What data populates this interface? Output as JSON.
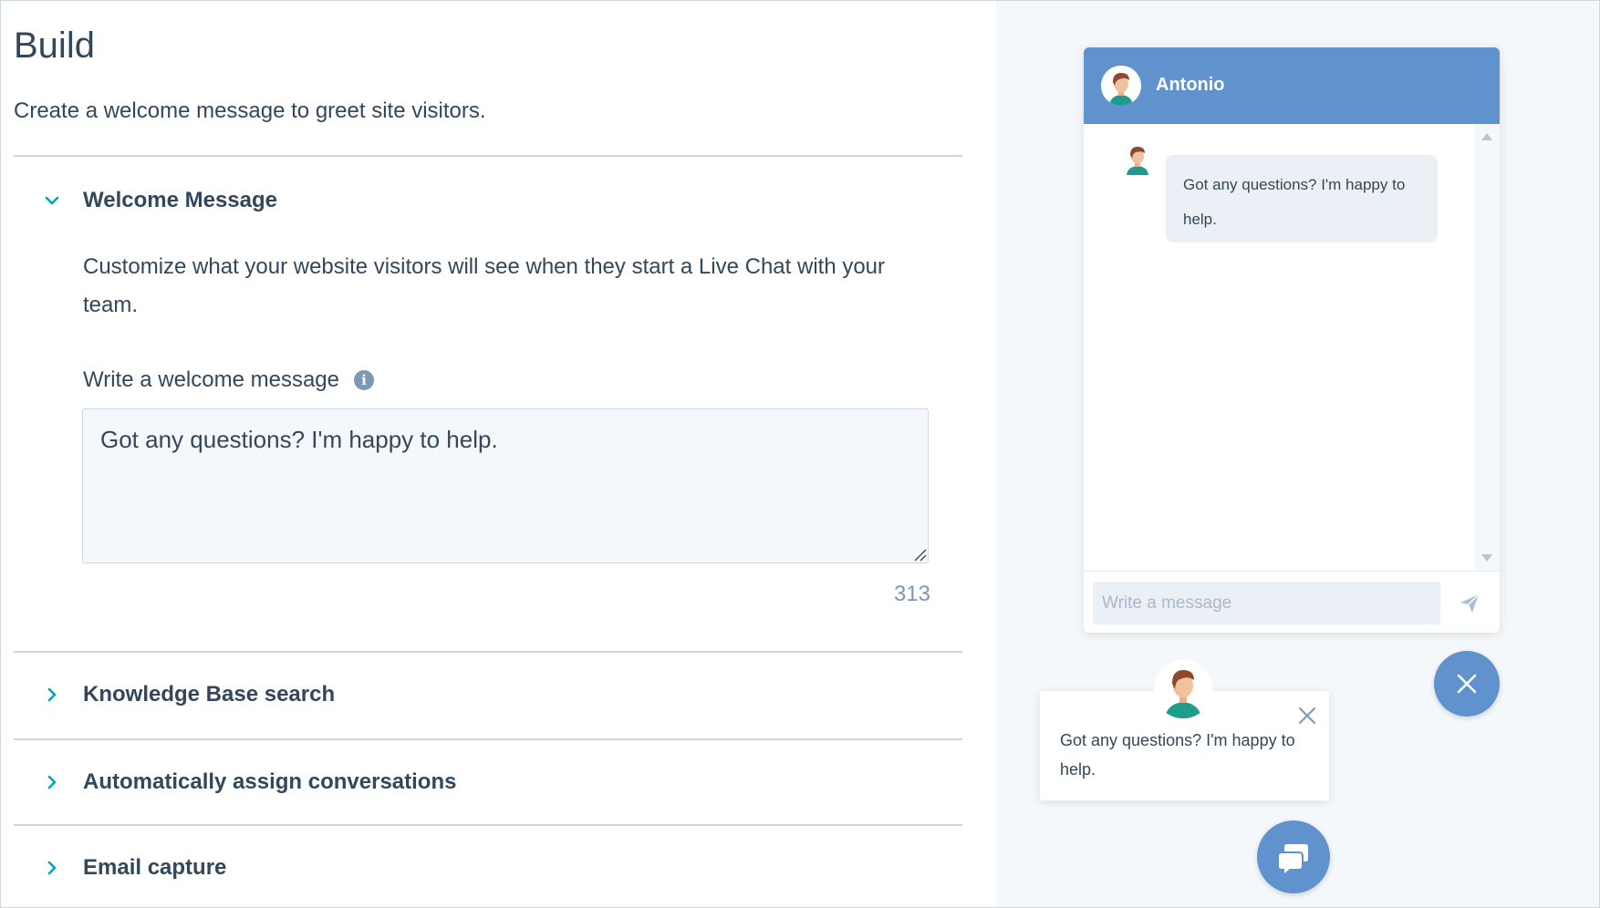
{
  "build": {
    "title": "Build",
    "subtitle": "Create a welcome message to greet site visitors."
  },
  "sections": {
    "welcome": {
      "label": "Welcome Message",
      "expanded": true,
      "description": "Customize what your website visitors will see when they start a Live Chat with your team.",
      "field_label": "Write a welcome message",
      "field_value": "Got any questions? I'm happy to help.",
      "char_count": "313"
    },
    "knowledge_base": {
      "label": "Knowledge Base search"
    },
    "auto_assign": {
      "label": "Automatically assign conversations"
    },
    "email_capture": {
      "label": "Email capture"
    }
  },
  "preview": {
    "agent_name": "Antonio",
    "message": "Got any questions? I'm happy to help.",
    "input_placeholder": "Write a message",
    "popup_message": "Got any questions? I'm happy to help."
  },
  "icons": {
    "expanded_chevron": "chevron-down-icon",
    "collapsed_chevron": "chevron-right-icon",
    "info": "info-icon",
    "send": "send-icon",
    "close": "close-icon",
    "chat": "chat-bubble-icon"
  },
  "colors": {
    "accent_teal": "#00a4bd",
    "chat_blue": "#6093ce",
    "text": "#33475b",
    "muted": "#7c98b6"
  }
}
